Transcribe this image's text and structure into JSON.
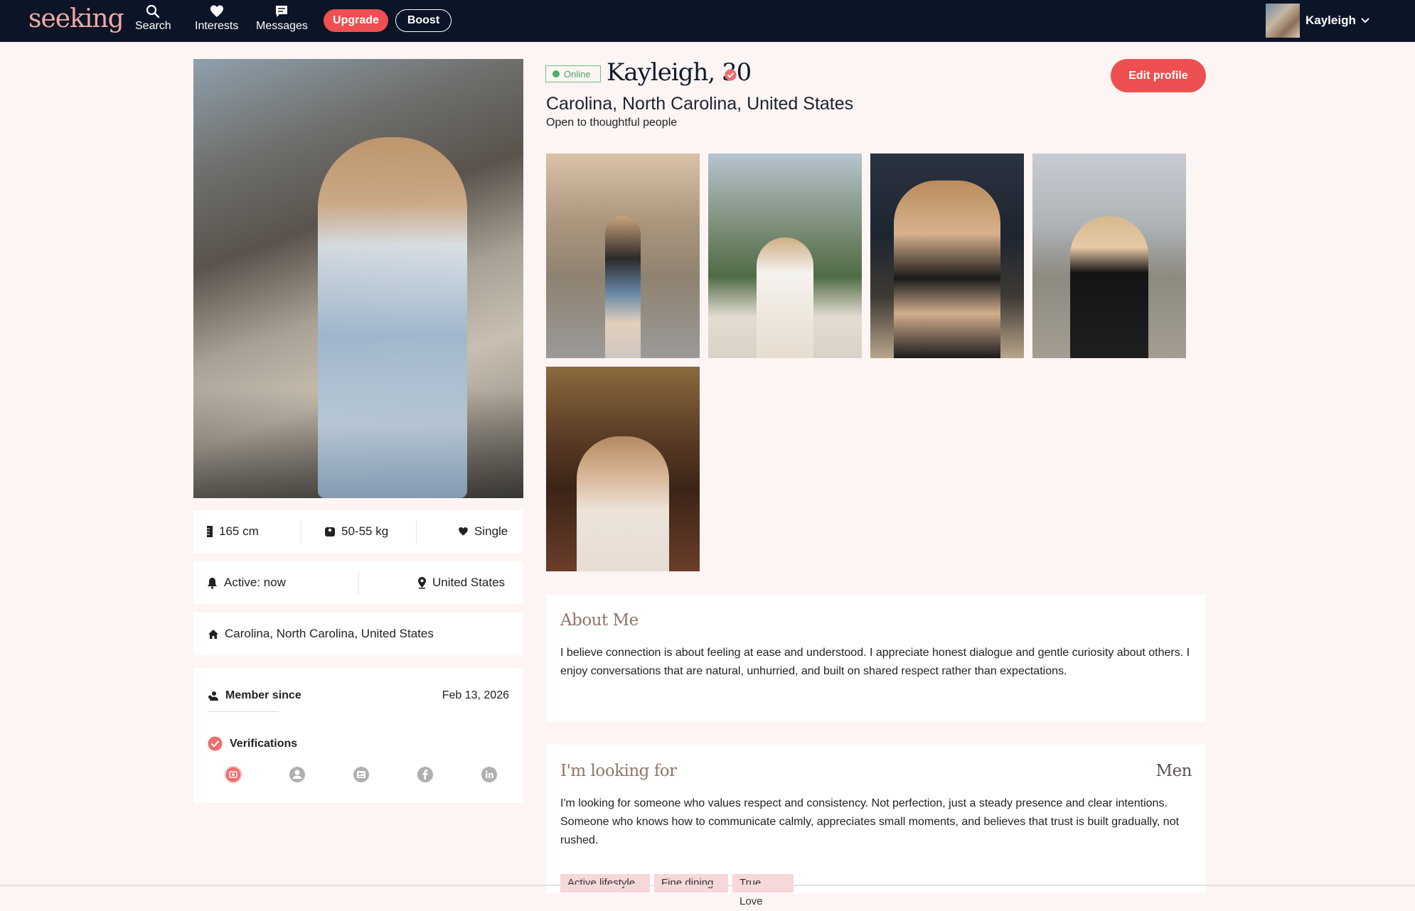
{
  "nav": {
    "logo": "seeking",
    "items": [
      {
        "label": "Search",
        "icon": "search-icon"
      },
      {
        "label": "Interests",
        "icon": "heart-icon"
      },
      {
        "label": "Messages",
        "icon": "chat-icon"
      }
    ],
    "upgrade_label": "Upgrade",
    "boost_label": "Boost",
    "user_name": "Kayleigh"
  },
  "profile": {
    "online_label": "Online",
    "name_age": "Kayleigh, 30",
    "location": "Carolina, North Carolina, United States",
    "tagline": "Open to thoughtful people",
    "edit_label": "Edit profile"
  },
  "stats": {
    "height": "165 cm",
    "weight": "50-55 kg",
    "relationship": "Single",
    "active": "Active: now",
    "country": "United States",
    "hometown": "Carolina, North Carolina, United States",
    "member_since_label": "Member since",
    "member_since_date": "Feb 13, 2026",
    "verifications_label": "Verifications"
  },
  "about": {
    "title": "About Me",
    "text": "I believe connection is about feeling at ease and understood. I appreciate honest dialogue and gentle curiosity about others. I enjoy conversations that are natural, unhurried, and built on shared respect rather than expectations."
  },
  "looking_for": {
    "title": "I'm looking for",
    "target": "Men",
    "text": "I'm looking for someone who values respect and consistency. Not perfection, just a steady presence and clear intentions. Someone who knows how to communicate calmly, appreciates small moments, and believes that trust is built gradually, not rushed.",
    "tags": [
      "Active lifestyle",
      "Fine dining",
      "True Love"
    ]
  },
  "colors": {
    "nav_bg": "#0c1427",
    "accent": "#ee4f50",
    "page_bg": "#fdf5f3",
    "online": "#4caf66",
    "section_title": "#8f7568"
  }
}
